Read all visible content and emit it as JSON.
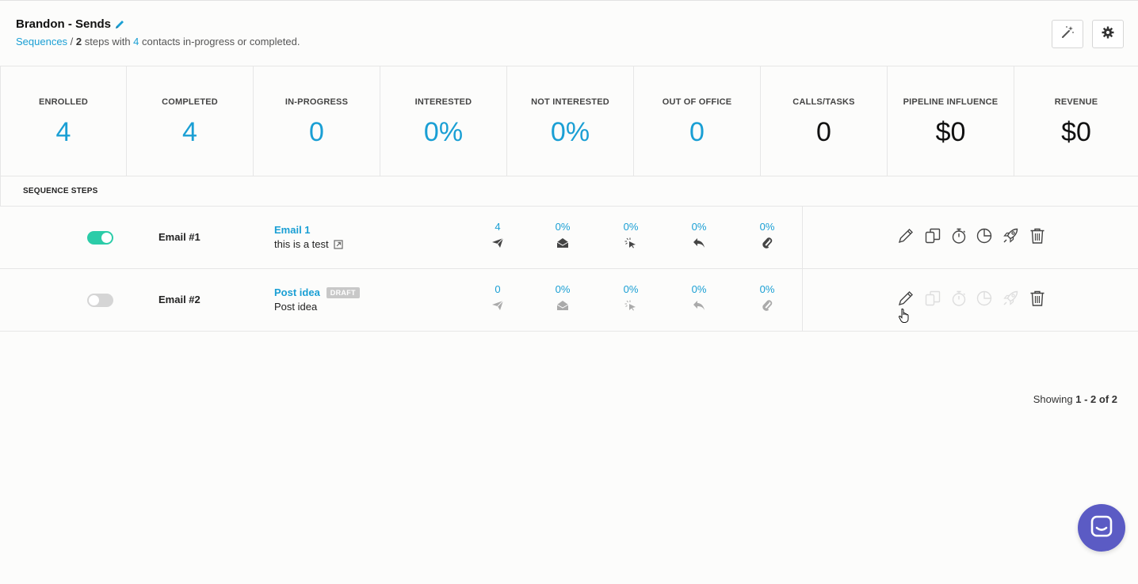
{
  "header": {
    "title": "Brandon - Sends",
    "breadcrumb_link": "Sequences",
    "sep": " / ",
    "step_count": "2",
    "steps_text": " steps with ",
    "contact_count": "4",
    "contacts_text": " contacts in-progress or completed."
  },
  "stats": [
    {
      "label": "ENROLLED",
      "value": "4"
    },
    {
      "label": "COMPLETED",
      "value": "4"
    },
    {
      "label": "IN-PROGRESS",
      "value": "0"
    },
    {
      "label": "INTERESTED",
      "value": "0%"
    },
    {
      "label": "NOT INTERESTED",
      "value": "0%"
    },
    {
      "label": "OUT OF OFFICE",
      "value": "0"
    },
    {
      "label": "CALLS/TASKS",
      "value": "0"
    },
    {
      "label": "PIPELINE INFLUENCE",
      "value": "$0"
    },
    {
      "label": "REVENUE",
      "value": "$0"
    }
  ],
  "steps_header": "SEQUENCE STEPS",
  "rows": [
    {
      "enabled": true,
      "name": "Email #1",
      "title": "Email 1",
      "subtitle": "this is a test",
      "draft": "",
      "metrics": {
        "sent": "4",
        "opened": "0%",
        "clicked": "0%",
        "replied": "0%",
        "bounced": "0%"
      }
    },
    {
      "enabled": false,
      "name": "Email #2",
      "title": "Post idea",
      "subtitle": "Post idea",
      "draft": "DRAFT",
      "metrics": {
        "sent": "0",
        "opened": "0%",
        "clicked": "0%",
        "replied": "0%",
        "bounced": "0%"
      }
    }
  ],
  "pagination": {
    "prefix": "Showing ",
    "range": "1 - 2 of 2"
  },
  "colors": {
    "accent": "#1a9fd4",
    "toggle_on": "#2bcca8",
    "chat": "#5b5bc4"
  },
  "icons": [
    "pencil-icon",
    "magic-wand-icon",
    "gear-icon",
    "send-icon",
    "open-envelope-icon",
    "click-icon",
    "reply-icon",
    "paperclip-icon",
    "edit-icon",
    "copy-icon",
    "timer-icon",
    "pie-chart-icon",
    "rocket-icon",
    "trash-icon",
    "external-link-icon",
    "chat-icon"
  ]
}
